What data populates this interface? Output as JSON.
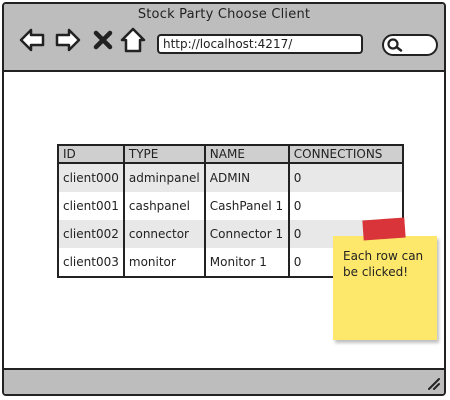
{
  "window": {
    "title": "Stock Party Choose Client",
    "url": "http://localhost:4217/"
  },
  "table": {
    "columns": [
      "ID",
      "TYPE",
      "NAME",
      "CONNECTIONS"
    ],
    "rows": [
      {
        "id": "client000",
        "type": "adminpanel",
        "name": "ADMIN",
        "connections": "0"
      },
      {
        "id": "client001",
        "type": "cashpanel",
        "name": "CashPanel 1",
        "connections": "0"
      },
      {
        "id": "client002",
        "type": "connector",
        "name": "Connector 1",
        "connections": "0"
      },
      {
        "id": "client003",
        "type": "monitor",
        "name": "Monitor 1",
        "connections": "0"
      }
    ]
  },
  "note": {
    "text": "Each row can be clicked!",
    "color": "#fde86b",
    "tape_color": "#d8343a"
  },
  "colors": {
    "chrome": "#bdbdbd",
    "header_bg": "#cfcfcf",
    "row_stripe": "#e8e8e8"
  }
}
